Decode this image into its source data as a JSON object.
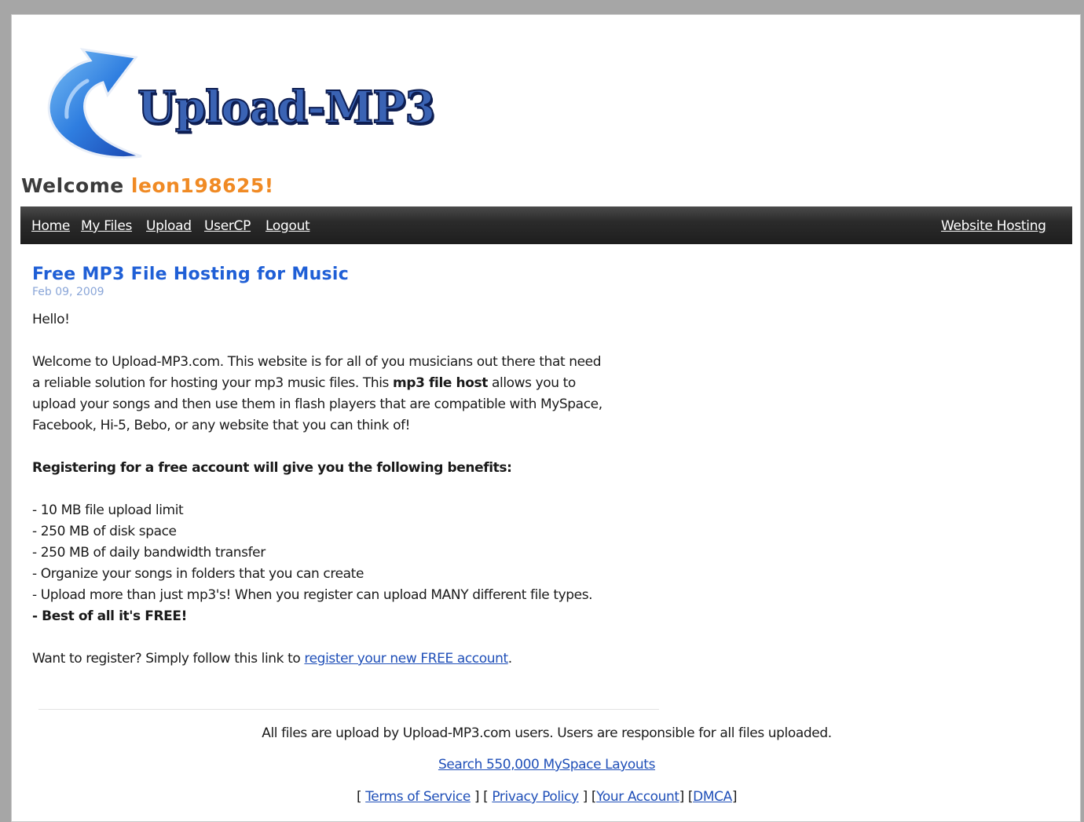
{
  "logo": {
    "text": "Upload-MP3",
    "icon": "curved-arrow-logo-icon",
    "colors": {
      "arrow_light": "#5aa8f0",
      "arrow_dark": "#1f55c8",
      "text_fill": "#3a63b4",
      "text_outline": "#0e1e52"
    }
  },
  "welcome": {
    "prefix": "Welcome ",
    "username": "leon198625!",
    "username_color": "#f08a24"
  },
  "nav": {
    "home": "Home",
    "my_files": "My Files",
    "upload": "Upload",
    "usercp": "UserCP",
    "logout": "Logout",
    "website_hosting": "Website Hosting"
  },
  "article": {
    "title": "Free MP3 File Hosting for Music",
    "date": "Feb 09, 2009",
    "greeting": "Hello!",
    "intro": {
      "line1": "Welcome to Upload-MP3.com.  This website is for all of you musicians out there that need",
      "line2_a": "a reliable solution for hosting your mp3 music files.  This ",
      "line2_bold": "mp3 file host",
      "line2_b": " allows you to",
      "line3": "upload your songs and then use them in flash players that are compatible with MySpace,",
      "line4": "Facebook, Hi-5, Bebo, or any website that you can think of!"
    },
    "benefits_heading": "Registering for a free account will give you the following benefits:",
    "benefits": [
      "- 10 MB file upload limit",
      "- 250 MB of disk space",
      "- 250 MB of daily bandwidth transfer",
      "- Organize your songs in folders that you can create",
      "- Upload more than just mp3's!  When you register can upload MANY different file types."
    ],
    "benefits_final": "- Best of all it's FREE!",
    "register_prefix": "Want to register? Simply follow this link to ",
    "register_link": "register your new FREE account",
    "register_suffix": "."
  },
  "footer": {
    "disclaimer": "All files are upload by Upload-MP3.com users. Users are responsible for all files uploaded.",
    "search_link": "Search 550,000 MySpace Layouts",
    "links": {
      "terms": "Terms of Service",
      "privacy": "Privacy Policy",
      "account": "Your Account",
      "dmca": "DMCA"
    },
    "brackets": {
      "open": "[ ",
      "mid1": " ] [ ",
      "mid2": " ] [",
      "mid3": "] [",
      "close": "]"
    }
  }
}
